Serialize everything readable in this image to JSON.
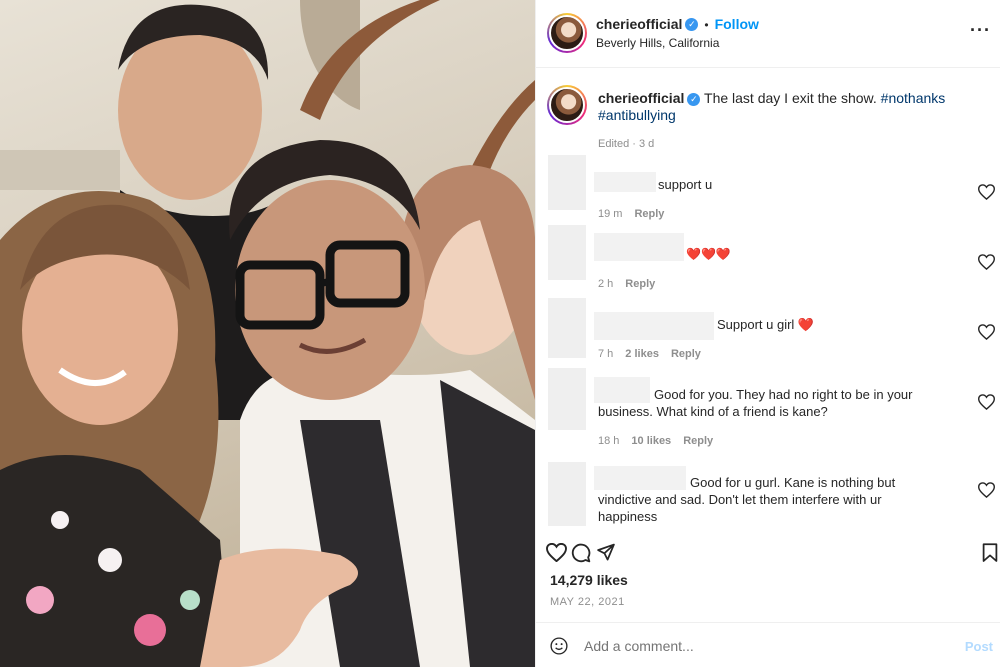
{
  "post": {
    "username": "cherieofficial",
    "verified_icon": "verified-badge-icon",
    "follow_label": "Follow",
    "location": "Beverly Hills, California",
    "more_icon": "more-options-icon",
    "caption_text": "The last day I exit the show.",
    "caption_tag_1": "#nothanks",
    "caption_tag_2": "#antibullying",
    "edited_label": "Edited",
    "edited_sep": "·",
    "edited_time": "3 d"
  },
  "comments": [
    {
      "text": "support u",
      "time": "19 m",
      "likes": "",
      "reply": "Reply"
    },
    {
      "text": "❤️❤️❤️",
      "time": "2 h",
      "likes": "",
      "reply": "Reply"
    },
    {
      "text": "Support u girl ❤️",
      "time": "7 h",
      "likes": "2 likes",
      "reply": "Reply"
    },
    {
      "text_line1": "Good for you. They had no right to be in your",
      "text_line2": "business. What kind of a friend is kane?",
      "time": "18 h",
      "likes": "10 likes",
      "reply": "Reply"
    },
    {
      "text_line1": "Good for u gurl. Kane is nothing but",
      "text_line2": "vindictive and sad. Don't let them interfere with ur",
      "text_line3": "happiness"
    }
  ],
  "actions": {
    "icons": [
      "heart-icon",
      "comment-icon",
      "share-icon",
      "bookmark-icon"
    ],
    "likes": "14,279 likes",
    "date": "MAY 22, 2021"
  },
  "add_comment": {
    "placeholder": "Add a comment...",
    "post_label": "Post",
    "emoji_icon": "emoji-icon"
  },
  "colors": {
    "link_blue": "#0095f6",
    "hashtag": "#00376b",
    "muted": "#8e8e8e",
    "post_disabled": "#b3dbff"
  }
}
